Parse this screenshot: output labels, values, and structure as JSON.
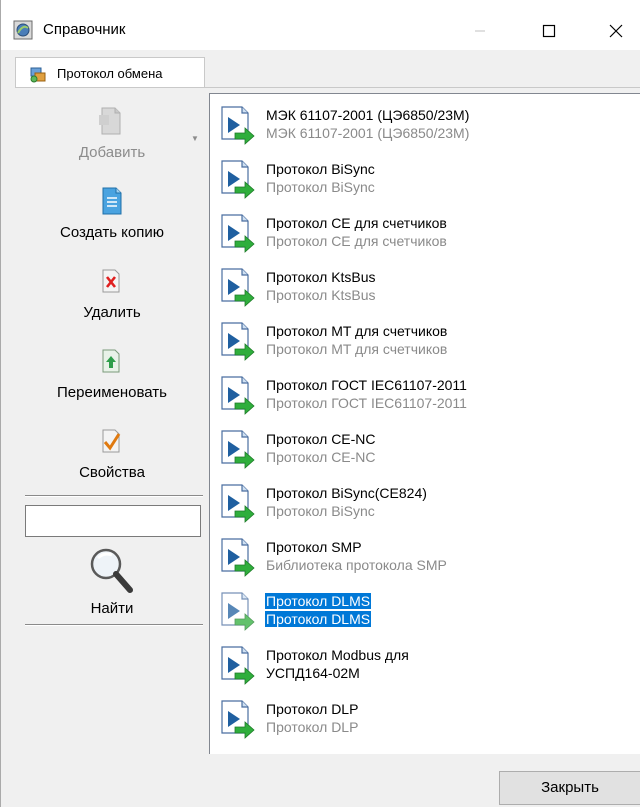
{
  "window": {
    "title": "Справочник",
    "controls": [
      "minimize-icon",
      "maximize-icon",
      "close-icon"
    ]
  },
  "tabs": [
    {
      "label": "Протокол обмена",
      "icon": "protocol-tab-icon",
      "active": true
    }
  ],
  "toolbar": {
    "add_label": "Добавить",
    "copy_label": "Создать копию",
    "delete_label": "Удалить",
    "rename_label": "Переименовать",
    "properties_label": "Свойства",
    "search_value": "",
    "find_label": "Найти"
  },
  "protocols": [
    {
      "name": "МЭК 61107-2001 (ЦЭ6850/23М)",
      "sub": "МЭК 61107-2001 (ЦЭ6850/23М)"
    },
    {
      "name": "Протокол BiSync",
      "sub": "Протокол BiSync"
    },
    {
      "name": "Протокол CE для счетчиков",
      "sub": "Протокол CE для счетчиков"
    },
    {
      "name": "Протокол KtsBus",
      "sub": "Протокол KtsBus"
    },
    {
      "name": "Протокол MT для счетчиков",
      "sub": "Протокол MT для счетчиков"
    },
    {
      "name": "Протокол ГОСТ IEC61107-2011",
      "sub": "Протокол ГОСТ IEC61107-2011"
    },
    {
      "name": "Протокол CE-NC",
      "sub": "Протокол CE-NC"
    },
    {
      "name": "Протокол BiSync(CE824)",
      "sub": "Протокол BiSync"
    },
    {
      "name": "Протокол SMP",
      "sub": "Библиотека протокола SMP"
    },
    {
      "name": "Протокол DLMS",
      "sub": "Протокол DLMS",
      "selected": true
    },
    {
      "name": "Протокол Modbus для",
      "sub": "УСПД164-02М",
      "sub_dark": true
    },
    {
      "name": "Протокол DLP",
      "sub": "Протокол DLP"
    }
  ],
  "footer": {
    "close_label": "Закрыть"
  }
}
